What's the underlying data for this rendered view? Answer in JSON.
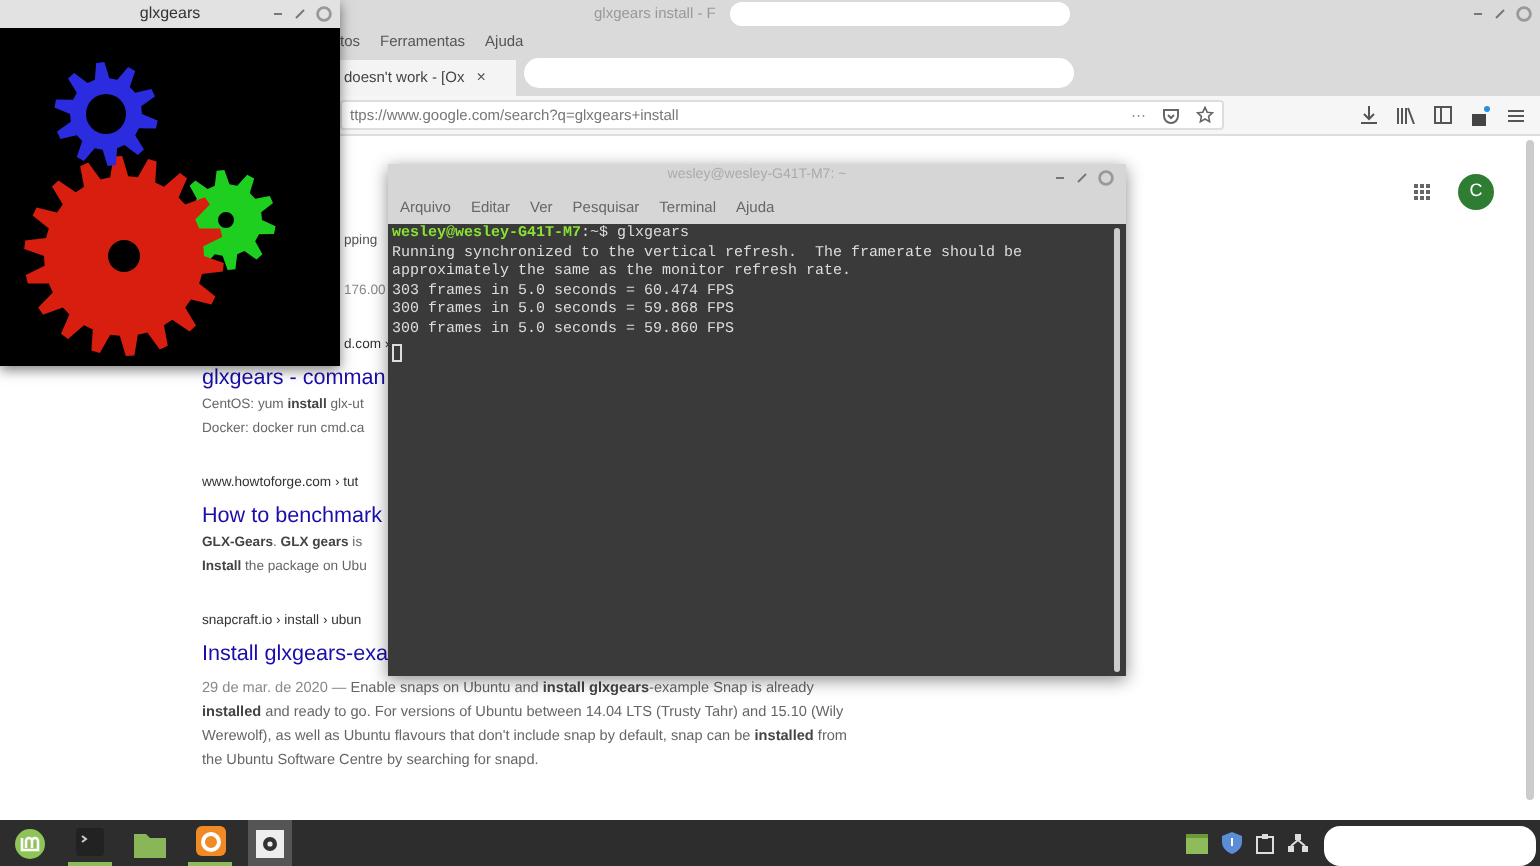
{
  "browser": {
    "title": "glxgears install - F",
    "menu": [
      "tos",
      "Ferramentas",
      "Ajuda"
    ],
    "tab": {
      "label": "doesn't work - [Ox",
      "close": "×"
    },
    "address": "ttps://www.google.com/search?q=glxgears+install",
    "page_actions": "···",
    "account_initial": "C"
  },
  "results": [
    {
      "kind": "tab",
      "text": "pping",
      "clipped": true
    },
    {
      "kind": "stats",
      "text": "176.00",
      "clipped": true
    },
    {
      "kind": "url",
      "text": "d.com ›",
      "clipped": true
    },
    {
      "kind": "title",
      "text": "glxgears - comman",
      "clipped": false
    },
    {
      "kind": "snippet",
      "text": "CentOS: yum **install** glx-ut",
      "clipped": false
    },
    {
      "kind": "snippet",
      "text": "Docker: docker run cmd.ca",
      "clipped": false
    },
    {
      "kind": "url",
      "text": "www.howtoforge.com › tut",
      "clipped": false
    },
    {
      "kind": "title",
      "text": "How to benchmark",
      "clipped": false
    },
    {
      "kind": "snippet",
      "text": "**GLX-Gears**. **GLX gears** is",
      "clipped": false
    },
    {
      "kind": "snippet",
      "text": "**Install** the package on Ubu",
      "clipped": false
    },
    {
      "kind": "url",
      "text": "snapcraft.io › install › ubun",
      "clipped": false
    },
    {
      "kind": "title",
      "text": "Install glxgears-exa",
      "clipped": false
    },
    {
      "kind": "snippet",
      "date": "29 de mar. de 2020 —",
      "text": "Enable snaps on Ubuntu and **install glxgears**-example Snap is already **installed** and ready to go. For versions of Ubuntu between 14.04 LTS (Trusty Tahr) and 15.10 (Wily Werewolf), as well as Ubuntu flavours that don't include snap by default, snap can be **installed** from the Ubuntu Software Centre by searching for snapd.",
      "clipped": false
    }
  ],
  "gears_window": {
    "title": "glxgears"
  },
  "terminal": {
    "title": "wesley@wesley-G41T-M7: ~",
    "menu": [
      "Arquivo",
      "Editar",
      "Ver",
      "Pesquisar",
      "Terminal",
      "Ajuda"
    ],
    "lines": [
      {
        "prompt": "wesley@wesley-G41T-M7",
        "text": ":~$ glxgears"
      },
      {
        "text": "Running synchronized to the vertical refresh.  The framerate should be"
      },
      {
        "text": "approximately the same as the monitor refresh rate."
      },
      {
        "text": "303 frames in 5.0 seconds = 60.474 FPS"
      },
      {
        "text": "300 frames in 5.0 seconds = 59.868 FPS"
      },
      {
        "text": "300 frames in 5.0 seconds = 59.860 FPS"
      }
    ]
  }
}
